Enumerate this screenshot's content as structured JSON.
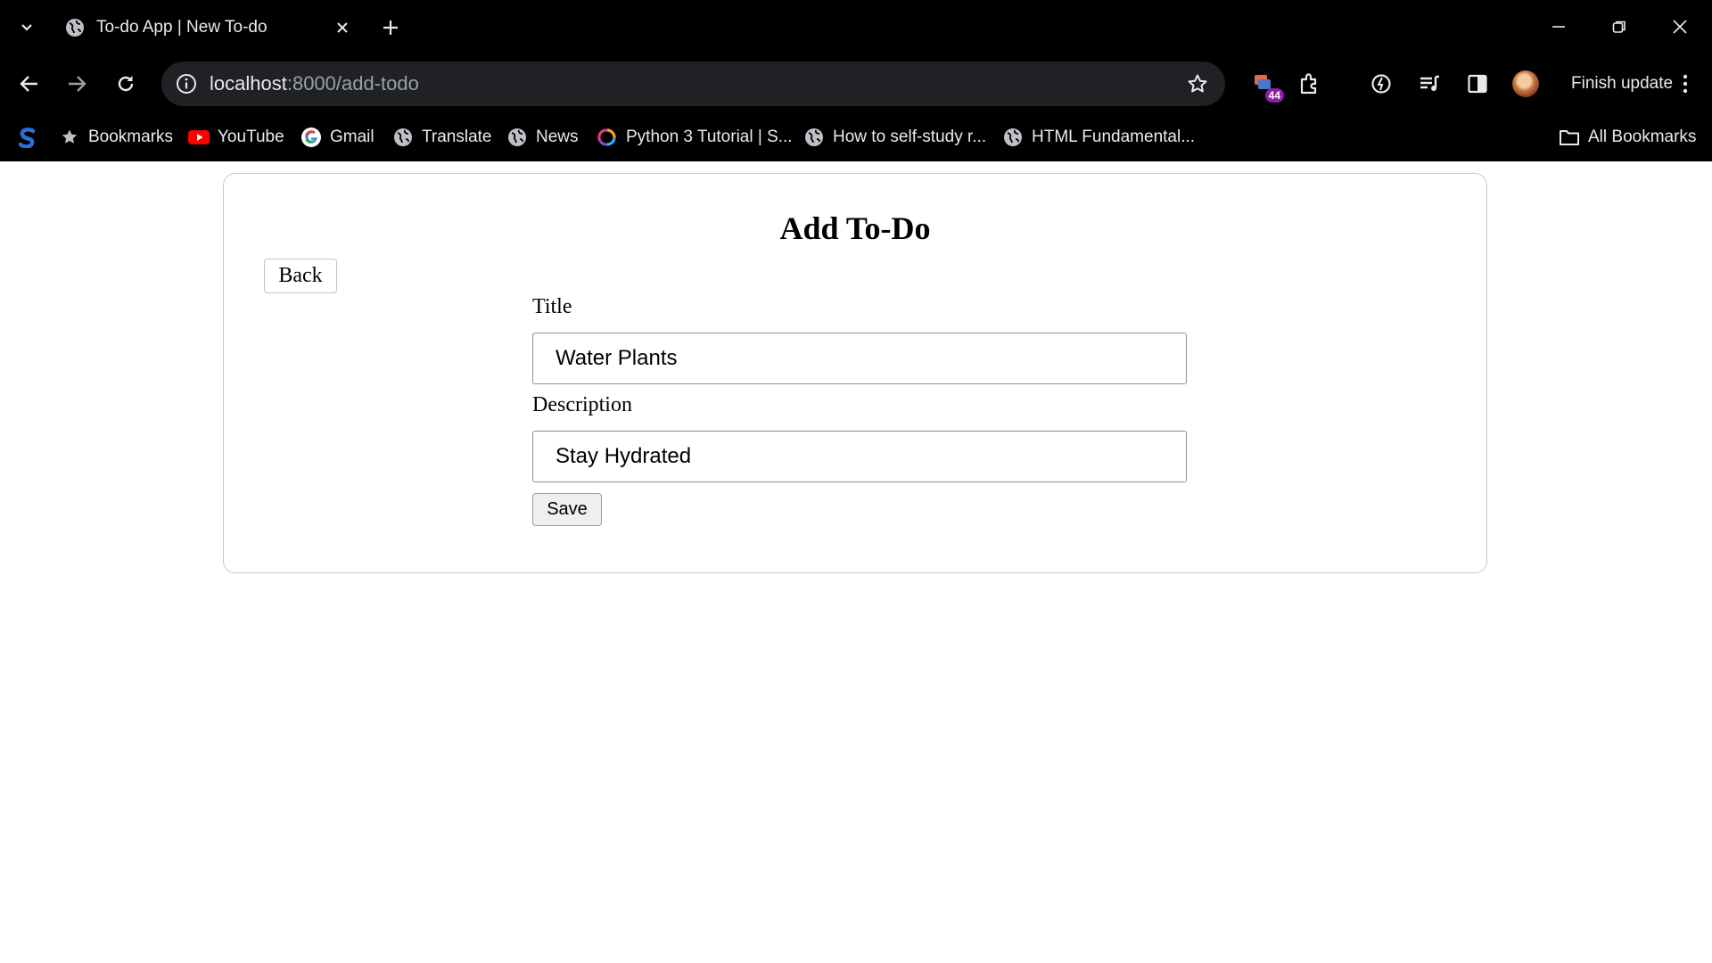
{
  "browser": {
    "tab": {
      "title": "To-do App | New To-do"
    },
    "omnibox": {
      "host": "localhost",
      "path": ":8000/add-todo"
    },
    "extensions_badge": "44",
    "finish_update_label": "Finish update",
    "bookmarks": {
      "items": [
        {
          "label": "Bookmarks",
          "icon": "star-icon"
        },
        {
          "label": "YouTube",
          "icon": "youtube-icon"
        },
        {
          "label": "Gmail",
          "icon": "google-icon"
        },
        {
          "label": "Translate",
          "icon": "globe-icon"
        },
        {
          "label": "News",
          "icon": "globe-icon"
        },
        {
          "label": "Python 3 Tutorial | S...",
          "icon": "sololearn-icon"
        },
        {
          "label": "How to self-study r...",
          "icon": "globe-icon"
        },
        {
          "label": "HTML Fundamental...",
          "icon": "globe-icon"
        }
      ],
      "all_bookmarks_label": "All Bookmarks"
    },
    "colors": {
      "frame": "#000000",
      "omnibox_bg": "#202124",
      "badge": "#8e1fa8"
    }
  },
  "page": {
    "heading": "Add To-Do",
    "back_label": "Back",
    "form": {
      "title_label": "Title",
      "title_value": "Water Plants",
      "description_label": "Description",
      "description_value": "Stay Hydrated",
      "save_label": "Save"
    }
  }
}
